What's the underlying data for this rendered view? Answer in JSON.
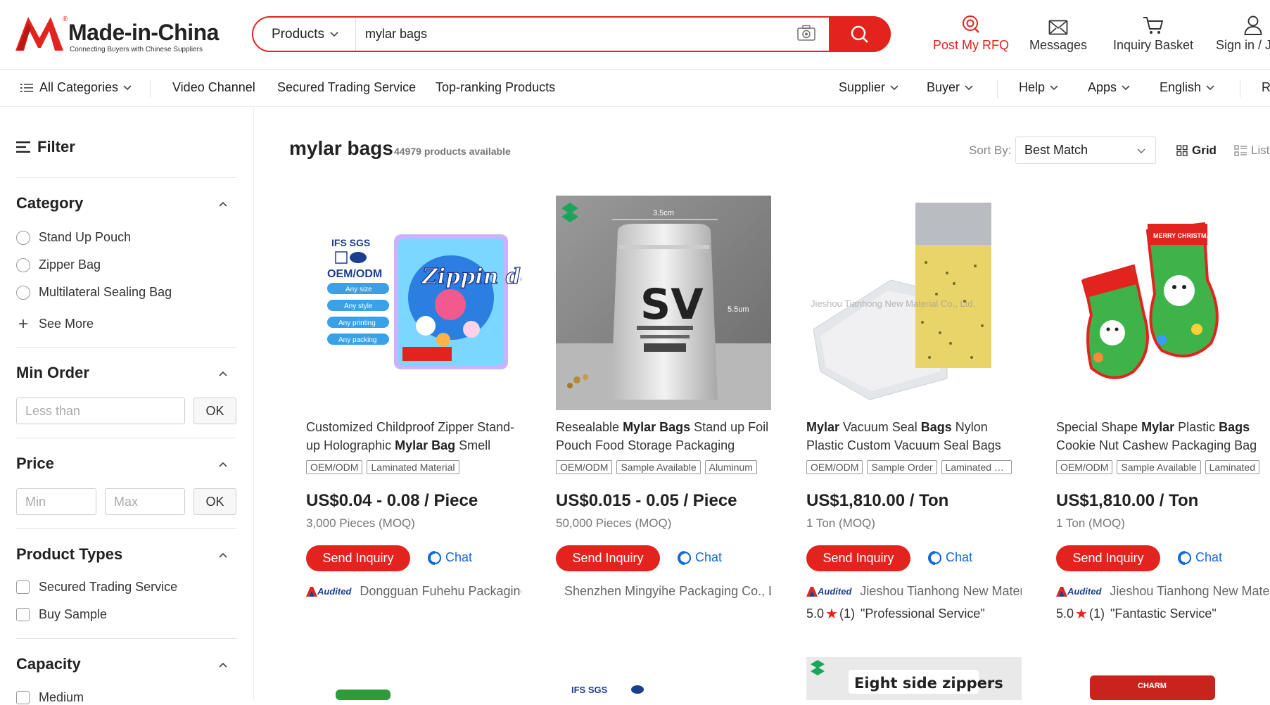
{
  "header": {
    "logo_text": "Made-in-China",
    "logo_tagline": "Connecting Buyers with Chinese Suppliers",
    "search": {
      "category": "Products",
      "value": "mylar bags"
    },
    "actions": [
      {
        "label": "Post My RFQ",
        "icon": "rfq-icon"
      },
      {
        "label": "Messages",
        "icon": "envelope-icon"
      },
      {
        "label": "Inquiry Basket",
        "icon": "cart-icon"
      },
      {
        "label": "Sign in / J",
        "icon": "user-icon"
      }
    ]
  },
  "nav": {
    "all_categories": "All Categories",
    "links": [
      "Video Channel",
      "Secured Trading Service",
      "Top-ranking Products"
    ],
    "right": [
      "Supplier",
      "Buyer",
      "Help",
      "Apps",
      "English"
    ],
    "cut": "R"
  },
  "sidebar": {
    "filter_title": "Filter",
    "category": {
      "title": "Category",
      "options": [
        "Stand Up Pouch",
        "Zipper Bag",
        "Multilateral Sealing Bag"
      ],
      "see_more": "See More"
    },
    "min_order": {
      "title": "Min Order",
      "placeholder": "Less than",
      "ok": "OK"
    },
    "price": {
      "title": "Price",
      "min_placeholder": "Min",
      "max_placeholder": "Max",
      "ok": "OK"
    },
    "product_types": {
      "title": "Product Types",
      "options": [
        "Secured Trading Service",
        "Buy Sample"
      ]
    },
    "capacity": {
      "title": "Capacity",
      "options": [
        "Medium"
      ]
    }
  },
  "results": {
    "title": "mylar bags",
    "count": "44979 products available",
    "sort_label": "Sort By:",
    "sort_value": "Best Match",
    "view_grid": "Grid",
    "view_list": "List"
  },
  "buttons": {
    "inquiry": "Send Inquiry",
    "chat": "Chat",
    "audited": "Audited"
  },
  "products": [
    {
      "title_pre": "Customized Childproof Zipper Stand-up Holographic ",
      "title_bold": "Mylar Bag",
      "title_post": " Smell Proof",
      "tags": [
        "OEM/ODM",
        "Laminated Material"
      ],
      "price": "US$0.04 - 0.08 / Piece",
      "moq": "3,000 Pieces (MOQ)",
      "supplier": "Dongguan Fuhehu Packaging",
      "audited": true,
      "img_text": {
        "cert": "IFS SGS",
        "oem": "OEM/ODM",
        "brand": "Zippin dots",
        "pills": [
          "Any size",
          "Any style",
          "Any printing",
          "Any packing"
        ]
      }
    },
    {
      "title_pre": "Resealable ",
      "title_bold": "Mylar Bags",
      "title_post": " Stand up Foil Pouch Food Storage Packaging",
      "tags": [
        "OEM/ODM",
        "Sample Available",
        "Aluminum"
      ],
      "price": "US$0.015 - 0.05 / Piece",
      "moq": "50,000 Pieces (MOQ)",
      "supplier": "Shenzhen Mingyihe Packaging Co., Ltd.",
      "audited": false,
      "img_text": {
        "brand": "SV",
        "dim_top": "3.5cm",
        "dim_side": "5.5um"
      }
    },
    {
      "title_pre": "",
      "title_bold": "Mylar",
      "title_mid": " Vacuum Seal ",
      "title_bold2": "Bags",
      "title_post": " Nylon Plastic Custom Vacuum Seal Bags Rice Grain",
      "tags": [
        "OEM/ODM",
        "Sample Order",
        "Laminated Material"
      ],
      "price": "US$1,810.00 / Ton",
      "moq": "1 Ton (MOQ)",
      "supplier": "Jieshou Tianhong New Material",
      "audited": true,
      "rating": {
        "score": "5.0",
        "count": "(1)",
        "quote": "\"Professional Service\""
      },
      "img_text": {
        "watermark": "Jieshou Tianhong New Material Co., Ltd."
      }
    },
    {
      "title_pre": "Special Shape ",
      "title_bold": "Mylar",
      "title_mid": " Plastic ",
      "title_bold2": "Bags",
      "title_post": " Cookie Nut Cashew Packaging Bag",
      "tags": [
        "OEM/ODM",
        "Sample Available",
        "Laminated"
      ],
      "price": "US$1,810.00 / Ton",
      "moq": "1 Ton (MOQ)",
      "supplier": "Jieshou Tianhong New Material",
      "audited": true,
      "rating": {
        "score": "5.0",
        "count": "(1)",
        "quote": "\"Fantastic Service\""
      },
      "img_text": {
        "banner": "MERRY CHRISTMAS"
      }
    }
  ],
  "row2": {
    "img3_text": "Eight side zippers",
    "img2_text": "IFS SGS",
    "img4_text": "CHARM"
  },
  "colors": {
    "brand_red": "#e3231d",
    "chat_blue": "#1667d9",
    "audited_blue": "#1b3f8f"
  }
}
